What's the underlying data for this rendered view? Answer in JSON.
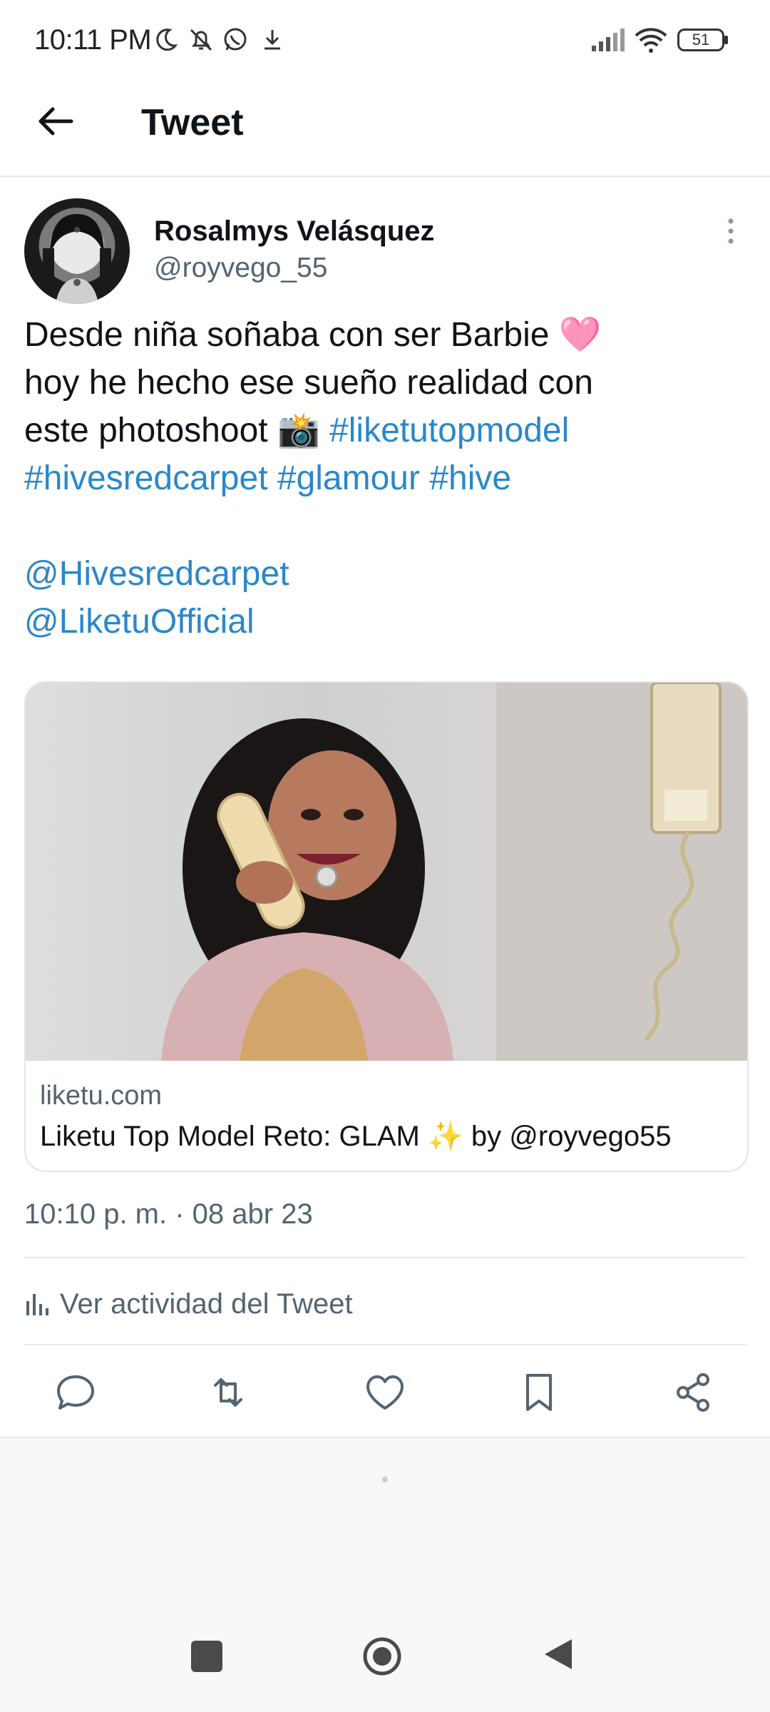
{
  "status_bar": {
    "time": "10:11 PM",
    "battery": "51",
    "icons": [
      "moon-icon",
      "bell-off-icon",
      "whatsapp-icon",
      "download-icon",
      "signal-icon",
      "wifi-icon",
      "battery-icon"
    ]
  },
  "header": {
    "title": "Tweet",
    "back_icon": "arrow-left-icon"
  },
  "tweet": {
    "author_name": "Rosalmys Velásquez",
    "author_handle": "@royvego_55",
    "text_line1": "Desde niña soñaba con ser Barbie 🩷",
    "text_line2": "hoy he hecho ese sueño realidad con",
    "text_line3_plain": "este photoshoot 📸 ",
    "hashtags_line3": "#liketutopmodel",
    "hashtags_line4": "#hivesredcarpet #glamour #hive",
    "mention1": "@Hivesredcarpet",
    "mention2": "@LiketuOfficial",
    "card": {
      "domain": "liketu.com",
      "title": "Liketu Top Model Reto: GLAM ✨ by @royvego55"
    },
    "timestamp": "10:10 p. m. · 08 abr 23",
    "activity_label": "Ver actividad del Tweet",
    "actions": [
      "reply-icon",
      "retweet-icon",
      "like-icon",
      "bookmark-icon",
      "share-icon"
    ]
  },
  "colors": {
    "link": "#2b87c9",
    "secondary_text": "#536471",
    "divider": "#e7e9ea"
  },
  "nav_bar": {
    "buttons": [
      "recents-square-icon",
      "home-circle-icon",
      "back-triangle-icon"
    ]
  }
}
